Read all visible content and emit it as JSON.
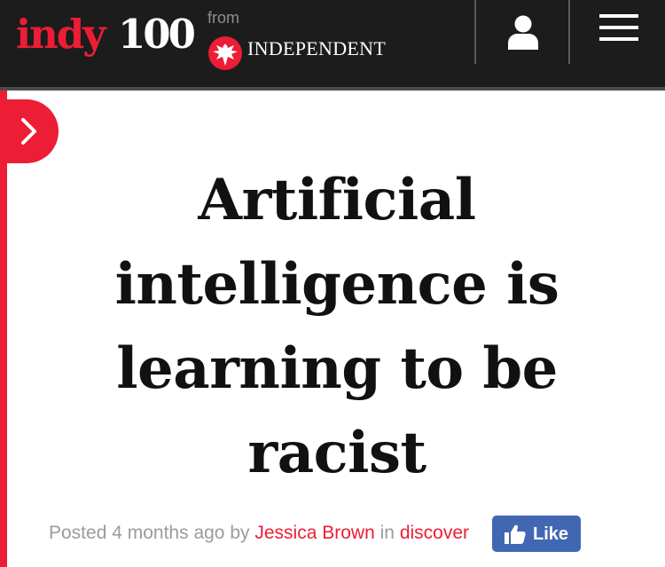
{
  "header": {
    "logo": {
      "brand_indy": "indy",
      "brand_100": "100",
      "from_text": "from",
      "publisher": "INDEPENDENT"
    },
    "icons": {
      "publisher_logo": "eagle-icon",
      "account": "user-icon",
      "menu": "hamburger-menu-icon"
    }
  },
  "side_nav": {
    "toggle_icon": "chevron-right-icon"
  },
  "article": {
    "title": "Artificial intelligence is learning to be racist",
    "byline": {
      "posted_prefix": "Posted",
      "time_ago": "4 months ago",
      "by_text": "by",
      "author": "Jessica Brown",
      "in_text": "in",
      "section": "discover"
    },
    "like_button": {
      "label": "Like",
      "icon": "thumbs-up-icon"
    }
  },
  "colors": {
    "brand_red": "#ec1d35",
    "header_bg": "#1c1c1c",
    "facebook_blue": "#4267b2",
    "byline_gray": "#9b9b9b"
  }
}
